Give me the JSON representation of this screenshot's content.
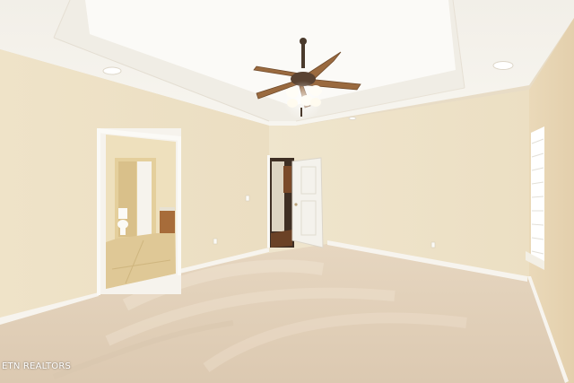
{
  "watermark": {
    "text": "ETN REALTORS"
  },
  "colors": {
    "wall": "#ece0c5",
    "wall_shadow": "#e2d5b8",
    "ceiling": "#f5f2ea",
    "tray": "#fbfaf6",
    "carpet": "#e2d1bc",
    "baseboard": "#f6f3ec",
    "fan_wood": "#9a6a3f",
    "tile": "#dfc896",
    "cabinet": "#a76c3a",
    "door": "#f4f2ec"
  },
  "icons": [
    "ceiling-fan-icon",
    "recessed-light-icon",
    "window-icon",
    "door-icon",
    "toilet-icon"
  ]
}
